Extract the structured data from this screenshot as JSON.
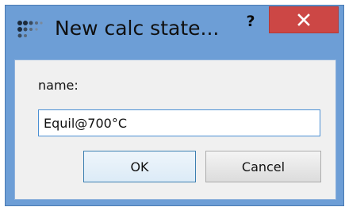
{
  "window": {
    "title": "New calc state...",
    "help_label": "?"
  },
  "form": {
    "name_label": "name:",
    "name_value": "Equil@700°C"
  },
  "buttons": {
    "ok_label": "OK",
    "cancel_label": "Cancel"
  },
  "colors": {
    "frame": "#6d9ed6",
    "close_button": "#cc4745",
    "client_bg": "#f0f0f0",
    "input_border": "#4a8fd4"
  },
  "icons": {
    "app": "dots-grid-icon",
    "close": "close-icon"
  }
}
